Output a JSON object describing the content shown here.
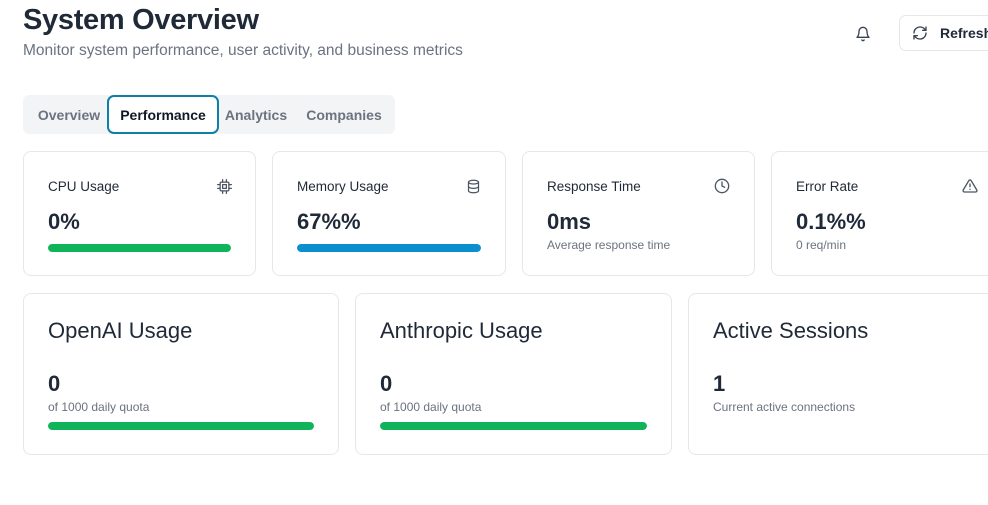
{
  "header": {
    "title": "System Overview",
    "subtitle": "Monitor system performance, user activity, and business metrics",
    "notifications_icon": "bell-icon",
    "refresh_label": "Refresh",
    "refresh_icon": "refresh-icon"
  },
  "tabs": [
    {
      "label": "Overview",
      "active": false
    },
    {
      "label": "Performance",
      "active": true
    },
    {
      "label": "Analytics",
      "active": false
    },
    {
      "label": "Companies",
      "active": false
    }
  ],
  "metrics": [
    {
      "label": "CPU Usage",
      "value": "0%",
      "subtext": "",
      "icon": "cpu-icon",
      "progress": 1.0,
      "bar_color": "#0fb35a"
    },
    {
      "label": "Memory Usage",
      "value": "67%%",
      "subtext": "",
      "icon": "database-icon",
      "progress": 1.0,
      "bar_color": "#0b8fcf"
    },
    {
      "label": "Response Time",
      "value": "0ms",
      "subtext": "Average response time",
      "icon": "clock-icon"
    },
    {
      "label": "Error Rate",
      "value": "0.1%%",
      "subtext": "0 req/min",
      "icon": "alert-triangle-icon"
    }
  ],
  "usage": [
    {
      "title": "OpenAI Usage",
      "value": "0",
      "subtext": "of 1000 daily quota",
      "progress": 1.0,
      "bar_color": "#0fb35a"
    },
    {
      "title": "Anthropic Usage",
      "value": "0",
      "subtext": "of 1000 daily quota",
      "progress": 1.0,
      "bar_color": "#0fb35a"
    },
    {
      "title": "Active Sessions",
      "value": "1",
      "subtext": "Current active connections"
    }
  ]
}
